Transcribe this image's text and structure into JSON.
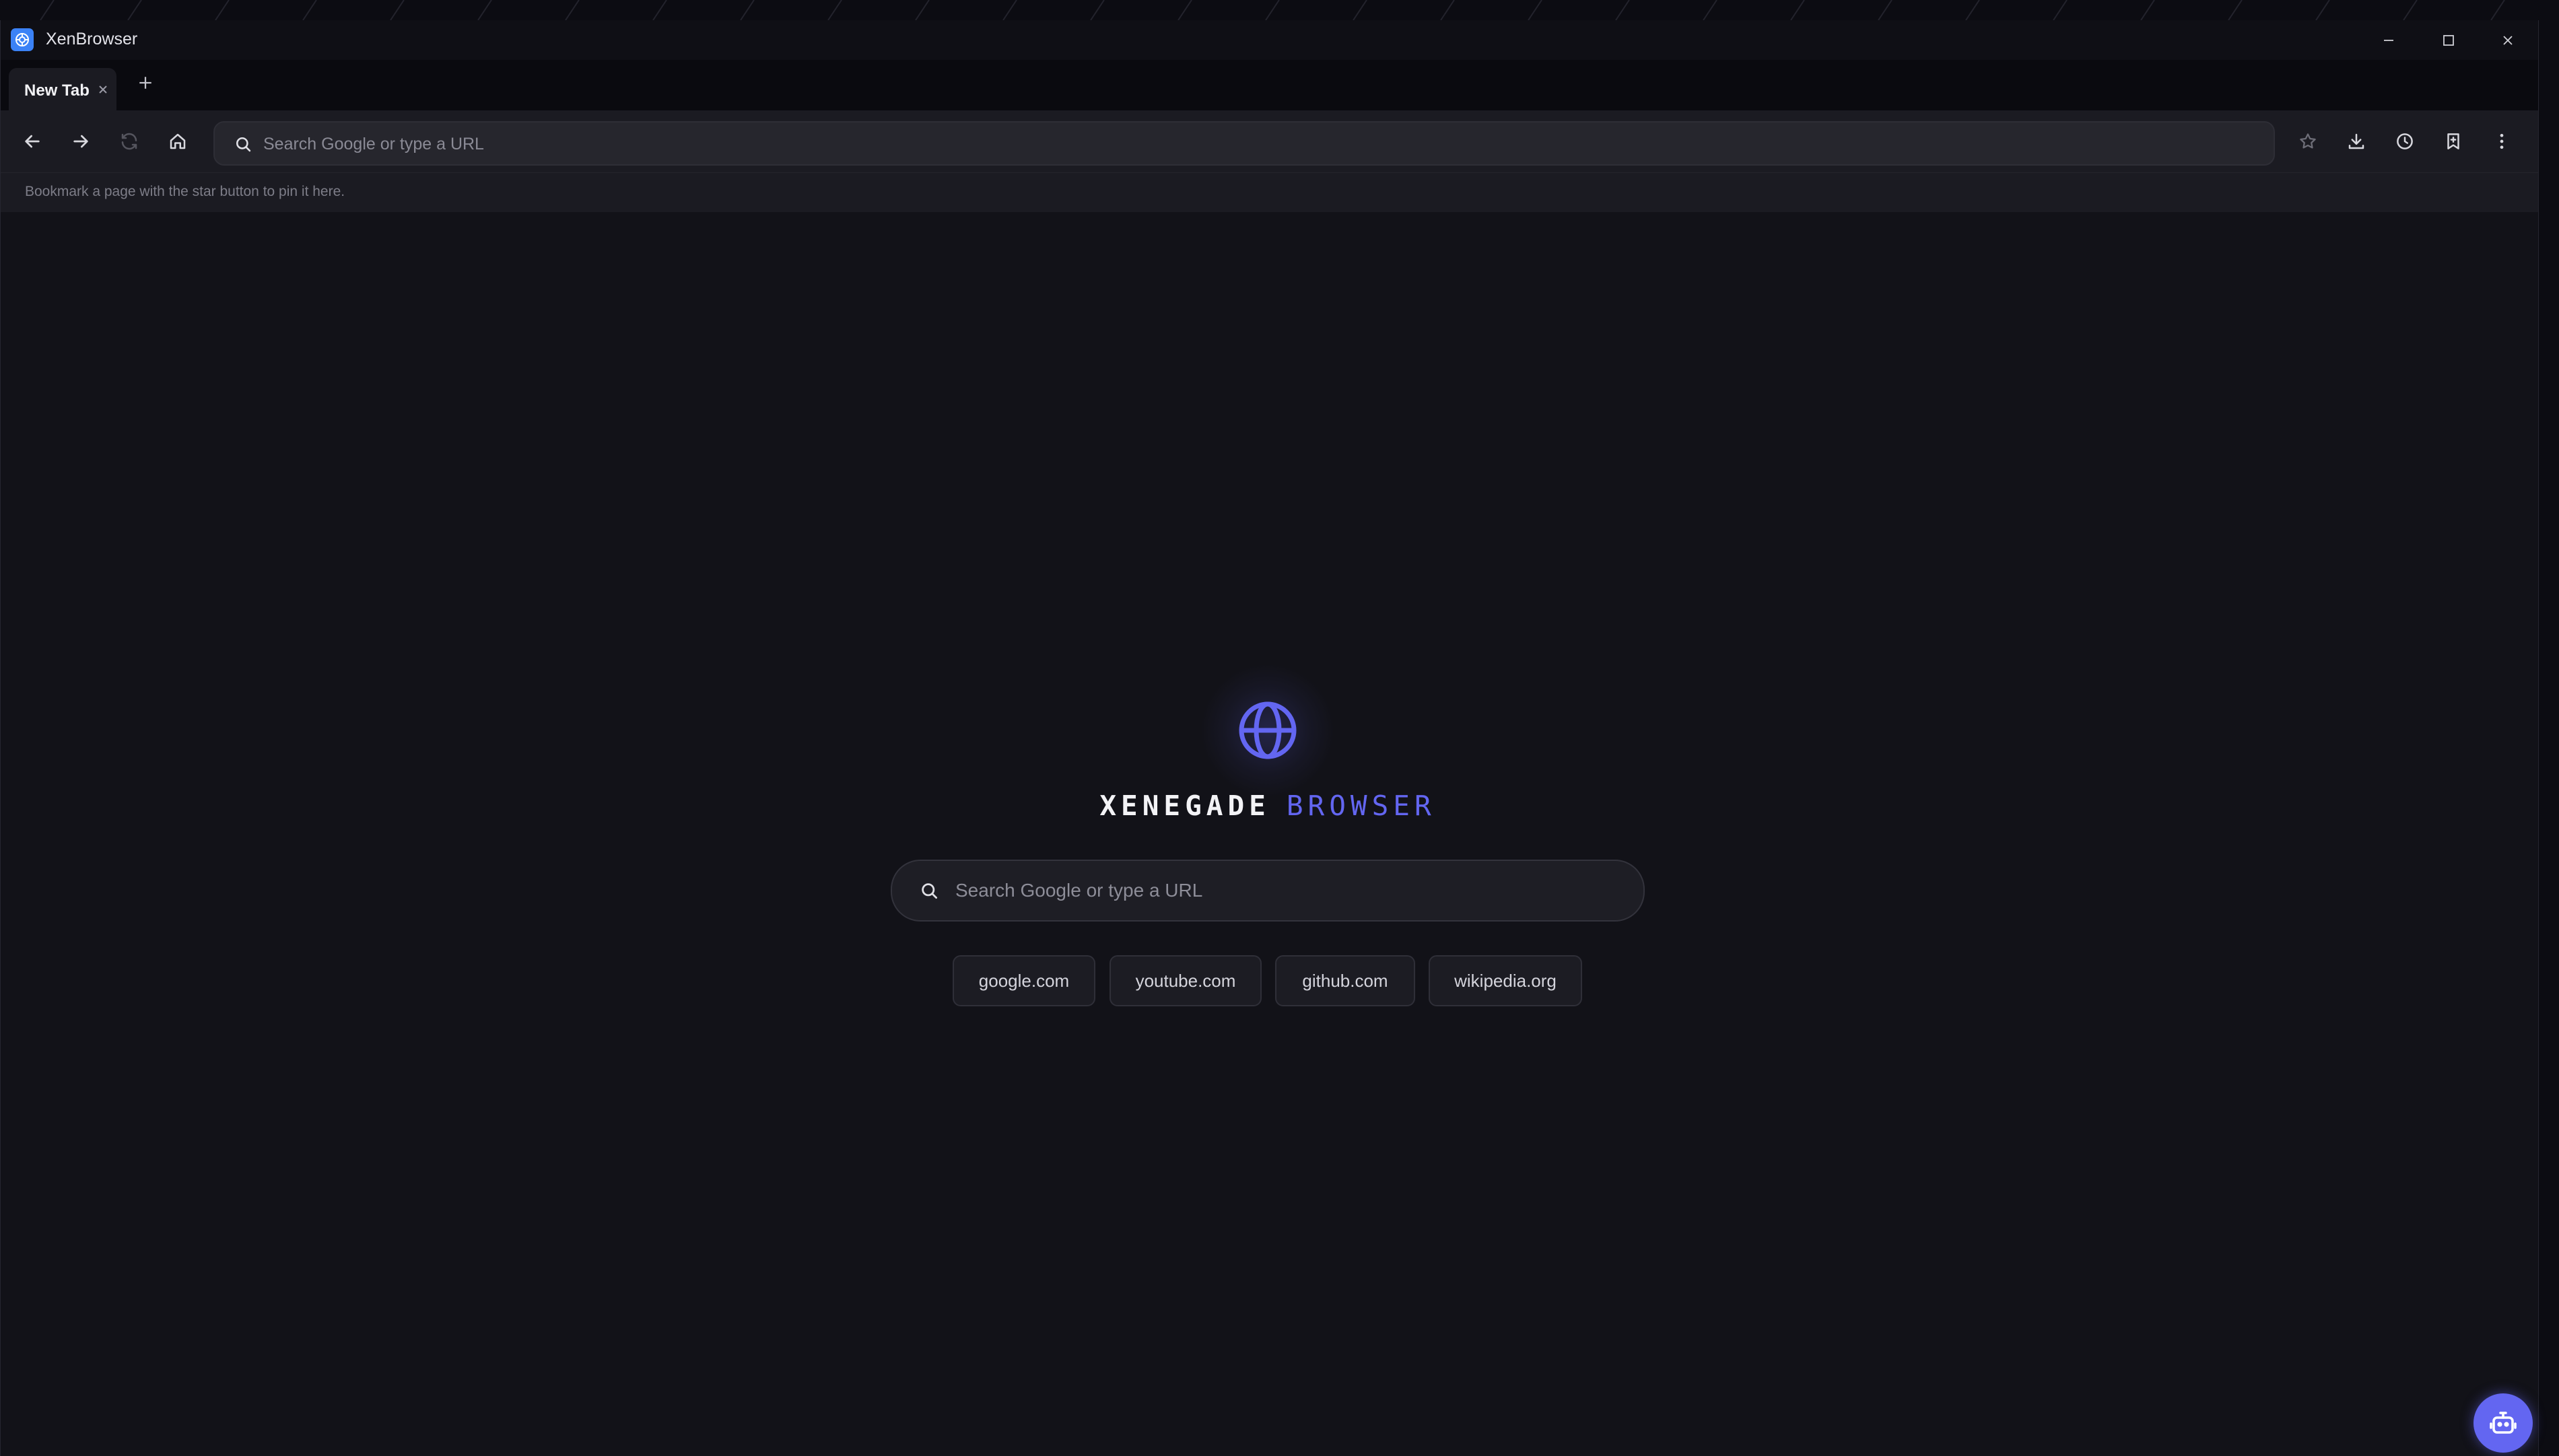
{
  "window": {
    "title": "XenBrowser"
  },
  "tabs": [
    {
      "label": "New Tab",
      "active": true
    }
  ],
  "toolbar": {
    "omnibox_placeholder": "Search Google or type a URL"
  },
  "bookmarks_bar": {
    "hint": "Bookmark a page with the star button to pin it here."
  },
  "new_tab_page": {
    "brand_primary": "XENEGADE",
    "brand_secondary": "BROWSER",
    "search_placeholder": "Search Google or type a URL",
    "quick_links": [
      "google.com",
      "youtube.com",
      "github.com",
      "wikipedia.org"
    ]
  },
  "colors": {
    "accent": "#6366f1",
    "background": "#121218",
    "toolbar": "#1b1b22"
  },
  "icons": {
    "app": "browser-logo-icon",
    "assistant": "robot-icon"
  }
}
